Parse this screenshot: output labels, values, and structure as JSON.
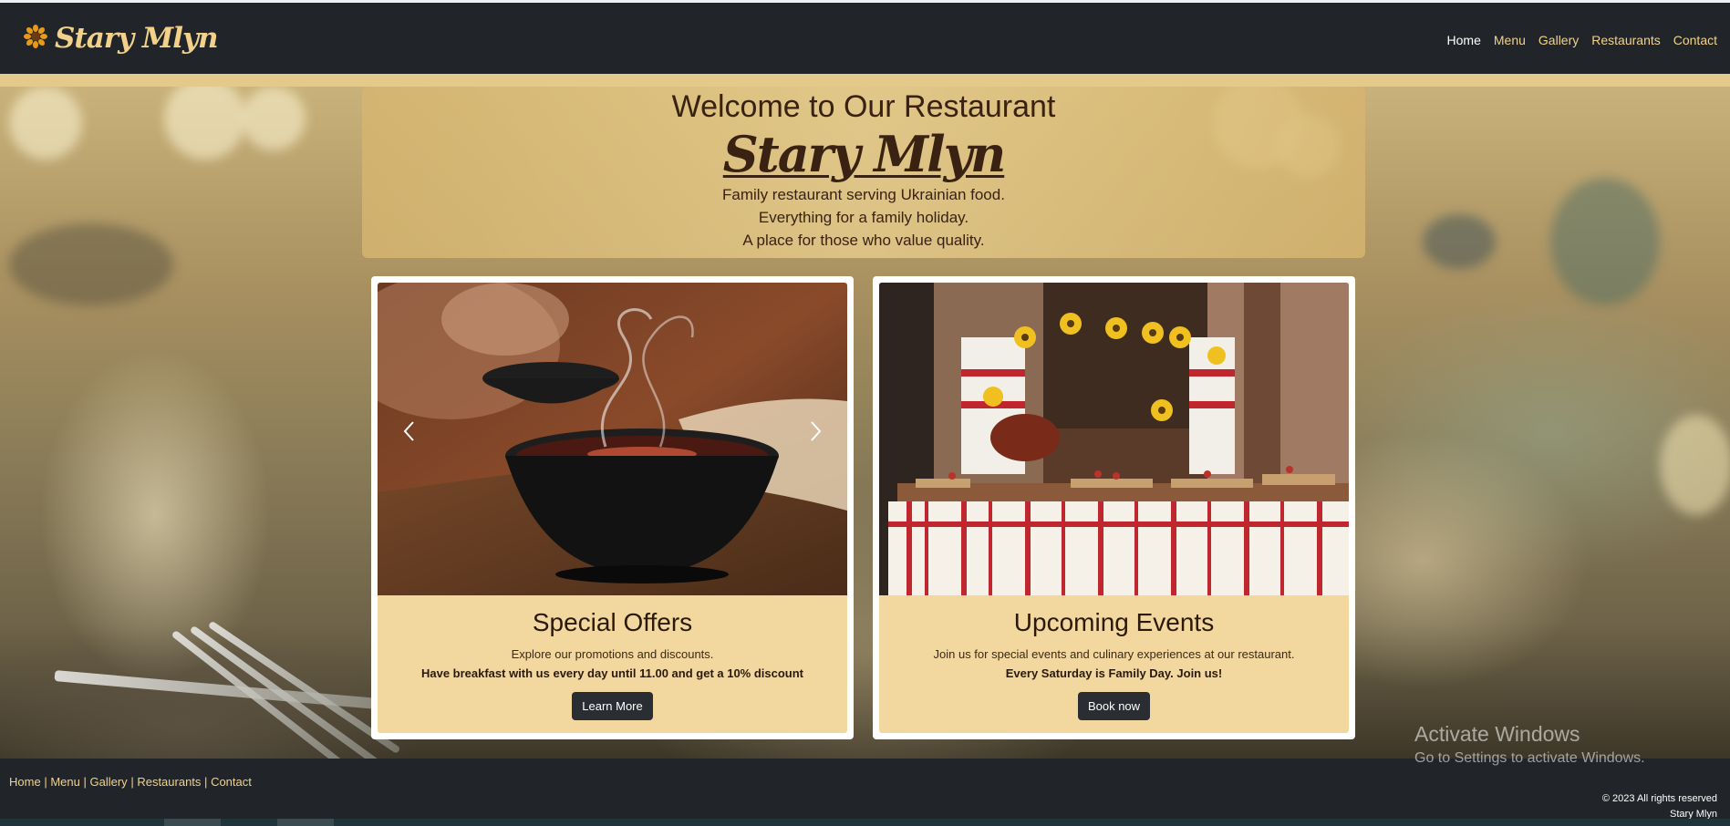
{
  "nav": {
    "brand": "Stary Mlyn",
    "links": [
      "Home",
      "Menu",
      "Gallery",
      "Restaurants",
      "Contact"
    ]
  },
  "welcome": {
    "heading": "Welcome to Our Restaurant",
    "brand": "Stary Mlyn",
    "lines": [
      "Family restaurant serving Ukrainian food.",
      "Everything for a family holiday.",
      "A place for those who value quality."
    ]
  },
  "cards": [
    {
      "title": "Special Offers",
      "description": "Explore our promotions and discounts.",
      "highlight": "Have breakfast with us every day until 11.00 and get a 10% discount",
      "button": "Learn More"
    },
    {
      "title": "Upcoming Events",
      "description": "Join us for special events and culinary experiences at our restaurant.",
      "highlight": "Every Saturday is Family Day. Join us!",
      "button": "Book now"
    }
  ],
  "footer": {
    "links": [
      "Home",
      "Menu",
      "Gallery",
      "Restaurants",
      "Contact"
    ],
    "copyright": "© 2023 All rights reserved",
    "company": "Stary Mlyn"
  },
  "watermark": {
    "title": "Activate Windows",
    "subtitle": "Go to Settings to activate Windows."
  },
  "icons": {
    "brand_logo": "sunflower-icon",
    "carousel_prev": "chevron-left-icon",
    "carousel_next": "chevron-right-icon"
  },
  "colors": {
    "navbar": "#212529",
    "accent": "#f2d28a",
    "card_body": "#f2d79e",
    "button": "#2a2d31",
    "heading_text": "#3a2212"
  }
}
